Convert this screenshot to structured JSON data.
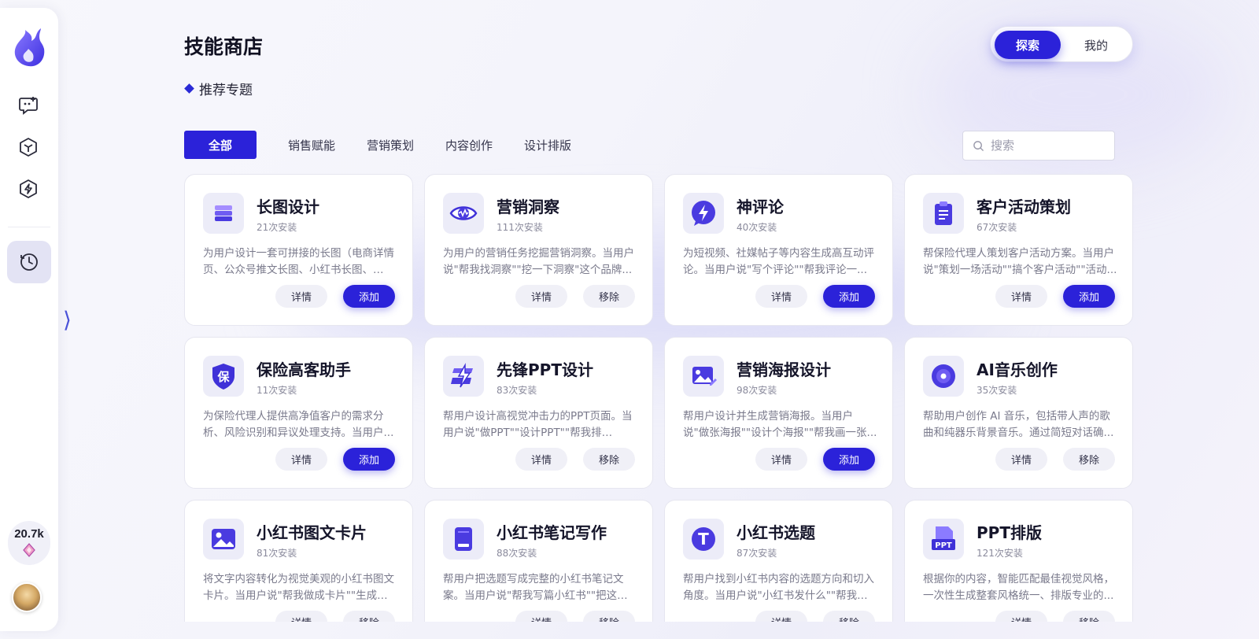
{
  "header": {
    "title": "技能商店",
    "topic_label": "推荐专题"
  },
  "toggle": {
    "explore_label": "探索",
    "mine_label": "我的"
  },
  "tabs": [
    "全部",
    "销售赋能",
    "营销策划",
    "内容创作",
    "设计排版"
  ],
  "search": {
    "placeholder": "搜索"
  },
  "sidebar": {
    "credits": "20.7k",
    "icons": [
      "new-chat-icon",
      "cube-icon",
      "lightning-icon",
      "history-icon"
    ]
  },
  "cards": [
    {
      "title": "长图设计",
      "installs": "21次安装",
      "desc": "为用户设计一套可拼接的长图（电商详情页、公众号推文长图、小红书长图、H5...",
      "detail": "详情",
      "action": "添加",
      "action_type": "add",
      "icon": "layers-icon"
    },
    {
      "title": "营销洞察",
      "installs": "111次安装",
      "desc": "为用户的营销任务挖掘营销洞察。当用户说\"帮我找洞察\"\"挖一下洞察\"这个品牌...",
      "detail": "详情",
      "action": "移除",
      "action_type": "remove",
      "icon": "eye-icon"
    },
    {
      "title": "神评论",
      "installs": "40次安装",
      "desc": "为短视频、社媒帖子等内容生成高互动评论。当用户说\"写个评论\"\"帮我评论一...",
      "detail": "详情",
      "action": "添加",
      "action_type": "add",
      "icon": "lightning-bubble-icon"
    },
    {
      "title": "客户活动策划",
      "installs": "67次安装",
      "desc": "帮保险代理人策划客户活动方案。当用户说\"策划一场活动\"\"搞个客户活动\"\"活动...",
      "detail": "详情",
      "action": "添加",
      "action_type": "add",
      "icon": "clipboard-icon"
    },
    {
      "title": "保险高客助手",
      "installs": "11次安装",
      "desc": "为保险代理人提供高净值客户的需求分析、风险识别和异议处理支持。当用户...",
      "detail": "详情",
      "action": "添加",
      "action_type": "add",
      "icon": "shield-icon",
      "icon_text": "保"
    },
    {
      "title": "先锋PPT设计",
      "installs": "83次安装",
      "desc": "帮用户设计高视觉冲击力的PPT页面。当用户说\"做PPT\"\"设计PPT\"\"帮我排版\"\"做...",
      "detail": "详情",
      "action": "移除",
      "action_type": "remove",
      "icon": "bolt-slide-icon"
    },
    {
      "title": "营销海报设计",
      "installs": "98次安装",
      "desc": "帮用户设计并生成营销海报。当用户说\"做张海报\"\"设计个海报\"\"帮我画一张...",
      "detail": "详情",
      "action": "添加",
      "action_type": "add",
      "icon": "image-edit-icon"
    },
    {
      "title": "AI音乐创作",
      "installs": "35次安装",
      "desc": "帮助用户创作 AI 音乐，包括带人声的歌曲和纯器乐背景音乐。通过简短对话确...",
      "detail": "详情",
      "action": "移除",
      "action_type": "remove",
      "icon": "disc-icon"
    },
    {
      "title": "小红书图文卡片",
      "installs": "81次安装",
      "desc": "将文字内容转化为视觉美观的小红书图文卡片。当用户说\"帮我做成卡片\"\"生成小...",
      "detail": "详情",
      "action": "移除",
      "action_type": "remove",
      "icon": "picture-icon"
    },
    {
      "title": "小红书笔记写作",
      "installs": "88次安装",
      "desc": "帮用户把选题写成完整的小红书笔记文案。当用户说\"帮我写篇小红书\"\"把这个...",
      "detail": "详情",
      "action": "移除",
      "action_type": "remove",
      "icon": "notebook-icon"
    },
    {
      "title": "小红书选题",
      "installs": "87次安装",
      "desc": "帮用户找到小红书内容的选题方向和切入角度。当用户说\"小红书发什么\"\"帮我想...",
      "detail": "详情",
      "action": "移除",
      "action_type": "remove",
      "icon": "text-t-icon",
      "icon_text": "T"
    },
    {
      "title": "PPT排版",
      "installs": "121次安装",
      "desc": "根据你的内容，智能匹配最佳视觉风格，一次性生成整套风格统一、排版专业的...",
      "detail": "详情",
      "action": "移除",
      "action_type": "remove",
      "icon": "ppt-file-icon",
      "icon_text": "PPT"
    }
  ]
}
